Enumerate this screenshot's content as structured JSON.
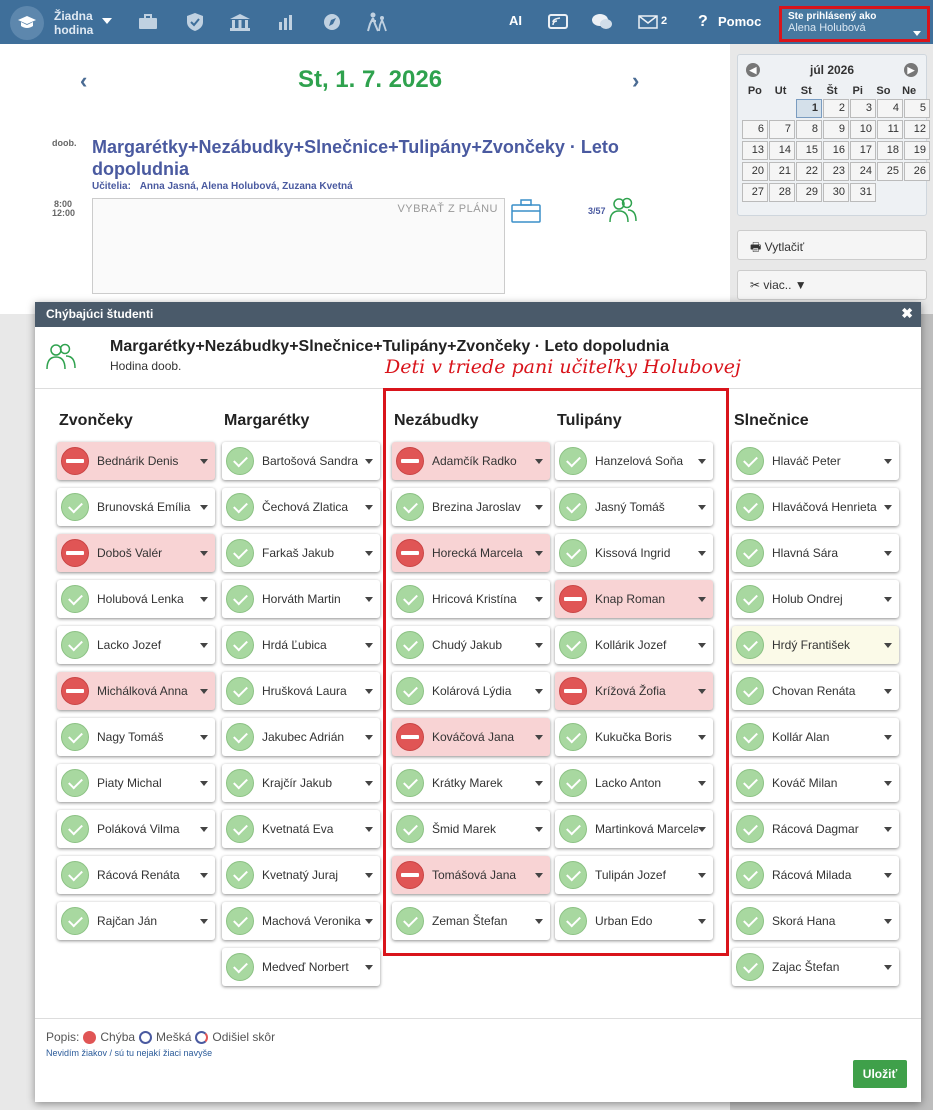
{
  "topbar": {
    "lesson_selector": "Žiadna hodina",
    "ai_label": "AI",
    "messages_count": "2",
    "help_label": "Pomoc",
    "user_caption": "Ste prihlásený ako",
    "user_name": "Alena Holubová"
  },
  "main": {
    "date": "St, 1. 7. 2026",
    "prev_arrow": "‹",
    "next_arrow": "›",
    "period_label": "doob.",
    "time_start": "8:00",
    "time_end": "12:00",
    "lesson_title": "Margarétky+Nezábudky+Slnečnice+Tulipány+Zvončeky · Leto dopoludnia",
    "teachers_label": "Učitelia:",
    "teachers": "Anna Jasná, Alena Holubová, Zuzana Kvetná",
    "plan_placeholder": "VYBRAŤ Z PLÁNU",
    "attendance_count": "3/57"
  },
  "calendar": {
    "month": "júl 2026",
    "weekdays": [
      "Po",
      "Ut",
      "St",
      "Št",
      "Pi",
      "So",
      "Ne"
    ],
    "days": [
      "",
      "",
      "1",
      "2",
      "3",
      "4",
      "5",
      "6",
      "7",
      "8",
      "9",
      "10",
      "11",
      "12",
      "13",
      "14",
      "15",
      "16",
      "17",
      "18",
      "19",
      "20",
      "21",
      "22",
      "23",
      "24",
      "25",
      "26",
      "27",
      "28",
      "29",
      "30",
      "31"
    ],
    "today": "1"
  },
  "side": {
    "print_label": "Vytlačiť",
    "more_label": "viac.. ▼"
  },
  "modal": {
    "header": "Chýbajúci študenti",
    "close": "✖",
    "title": "Margarétky+Nezábudky+Slnečnice+Tulipány+Zvončeky · Leto dopoludnia",
    "subtitle": "Hodina doob.",
    "annotation": "Deti v triede pani učiteľky Holubovej",
    "columns": [
      {
        "name": "Zvončeky",
        "students": [
          {
            "name": "Bednárik Denis",
            "status": "absent"
          },
          {
            "name": "Brunovská Emília",
            "status": "present"
          },
          {
            "name": "Doboš Valér",
            "status": "absent"
          },
          {
            "name": "Holubová Lenka",
            "status": "present"
          },
          {
            "name": "Lacko Jozef",
            "status": "present"
          },
          {
            "name": "Michálková Anna",
            "status": "absent"
          },
          {
            "name": "Nagy Tomáš",
            "status": "present"
          },
          {
            "name": "Piaty Michal",
            "status": "present"
          },
          {
            "name": "Poláková Vilma",
            "status": "present"
          },
          {
            "name": "Rácová Renáta",
            "status": "present"
          },
          {
            "name": "Rajčan Ján",
            "status": "present"
          }
        ]
      },
      {
        "name": "Margarétky",
        "students": [
          {
            "name": "Bartošová Sandra",
            "status": "present"
          },
          {
            "name": "Čechová Zlatica",
            "status": "present"
          },
          {
            "name": "Farkaš Jakub",
            "status": "present"
          },
          {
            "name": "Horváth Martin",
            "status": "present"
          },
          {
            "name": "Hrdá Ľubica",
            "status": "present"
          },
          {
            "name": "Hrušková Laura",
            "status": "present"
          },
          {
            "name": "Jakubec Adrián",
            "status": "present"
          },
          {
            "name": "Krajčír Jakub",
            "status": "present"
          },
          {
            "name": "Kvetnatá Eva",
            "status": "present"
          },
          {
            "name": "Kvetnatý Juraj",
            "status": "present"
          },
          {
            "name": "Machová Veronika",
            "status": "present"
          },
          {
            "name": "Medveď Norbert",
            "status": "present"
          }
        ]
      },
      {
        "name": "Nezábudky",
        "students": [
          {
            "name": "Adamčík Radko",
            "status": "absent"
          },
          {
            "name": "Brezina Jaroslav",
            "status": "present"
          },
          {
            "name": "Horecká Marcela",
            "status": "absent"
          },
          {
            "name": "Hricová Kristína",
            "status": "present"
          },
          {
            "name": "Chudý Jakub",
            "status": "present"
          },
          {
            "name": "Kolárová Lýdia",
            "status": "present"
          },
          {
            "name": "Kováčová Jana",
            "status": "absent"
          },
          {
            "name": "Krátky Marek",
            "status": "present"
          },
          {
            "name": "Šmid Marek",
            "status": "present"
          },
          {
            "name": "Tomášová Jana",
            "status": "absent"
          },
          {
            "name": "Zeman Štefan",
            "status": "present"
          }
        ]
      },
      {
        "name": "Tulipány",
        "students": [
          {
            "name": "Hanzelová Soňa",
            "status": "present"
          },
          {
            "name": "Jasný Tomáš",
            "status": "present"
          },
          {
            "name": "Kissová Ingrid",
            "status": "present"
          },
          {
            "name": "Knap Roman",
            "status": "absent"
          },
          {
            "name": "Kollárik Jozef",
            "status": "present"
          },
          {
            "name": "Krížová Žofia",
            "status": "absent"
          },
          {
            "name": "Kukučka Boris",
            "status": "present"
          },
          {
            "name": "Lacko Anton",
            "status": "present"
          },
          {
            "name": "Martinková Marcela",
            "status": "present"
          },
          {
            "name": "Tulipán Jozef",
            "status": "present"
          },
          {
            "name": "Urban Edo",
            "status": "present"
          }
        ]
      },
      {
        "name": "Slnečnice",
        "students": [
          {
            "name": "Hlaváč Peter",
            "status": "present"
          },
          {
            "name": "Hlaváčová Henrieta",
            "status": "present"
          },
          {
            "name": "Hlavná Sára",
            "status": "present"
          },
          {
            "name": "Holub Ondrej",
            "status": "present"
          },
          {
            "name": "Hrdý František",
            "status": "pending"
          },
          {
            "name": "Chovan Renáta",
            "status": "present"
          },
          {
            "name": "Kollár Alan",
            "status": "present"
          },
          {
            "name": "Kováč Milan",
            "status": "present"
          },
          {
            "name": "Rácová Dagmar",
            "status": "present"
          },
          {
            "name": "Rácová Milada",
            "status": "present"
          },
          {
            "name": "Skorá Hana",
            "status": "present"
          },
          {
            "name": "Zajac Štefan",
            "status": "present"
          }
        ]
      }
    ],
    "legend_label": "Popis:",
    "legend_absent": "Chýba",
    "legend_late": "Mešká",
    "legend_left": "Odišiel skôr",
    "link_text": "Nevidím žiakov / sú tu nejakí žiaci navyše",
    "save_label": "Uložiť"
  }
}
